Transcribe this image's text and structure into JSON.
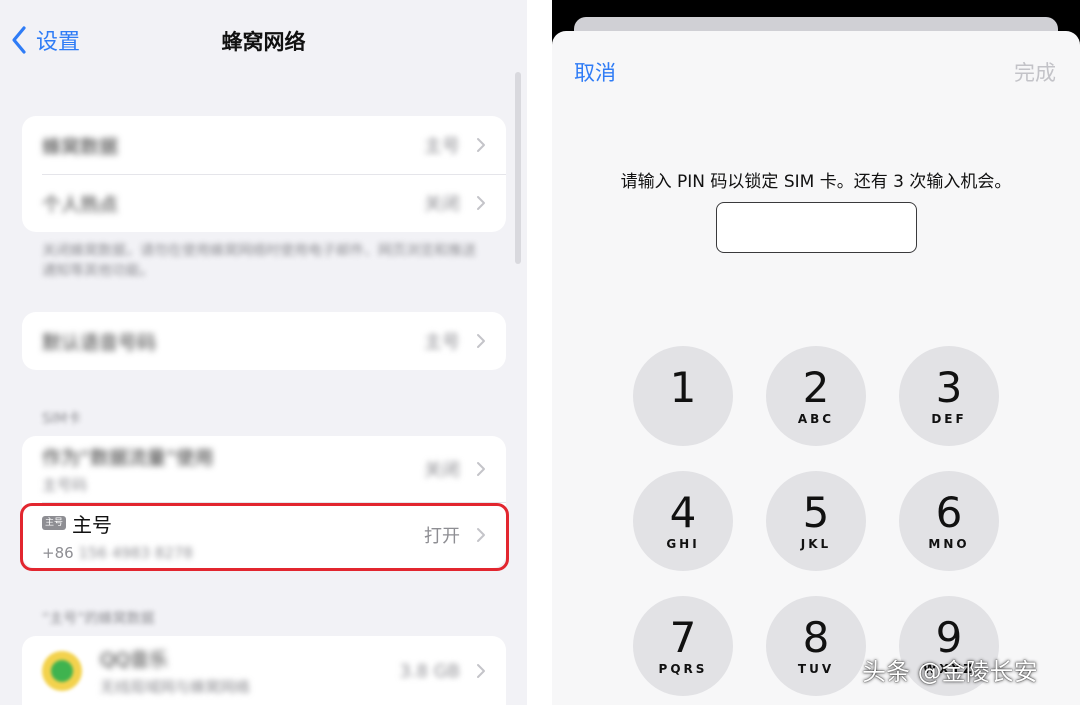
{
  "left": {
    "back_label": "设置",
    "title": "蜂窝网络",
    "group1": [
      {
        "label": "蜂窝数据",
        "value": "主号"
      },
      {
        "label": "个人热点",
        "value": "关闭"
      }
    ],
    "footnote": "关闭蜂窝数据，请勿在使用蜂窝网络时使用电子邮件、网页浏览和推送通知等其他功能。",
    "voice_row": {
      "label": "默认语音号码",
      "value": "主号"
    },
    "sim_header": "SIM卡",
    "data_row": {
      "label": "作为“数据流量”使用",
      "sub": "主号码",
      "value": "关闭"
    },
    "main_row": {
      "badge": "主号",
      "label": "主号",
      "phone_prefix": "+86",
      "phone_rest": "156 4983 8278",
      "value": "打开"
    },
    "usage_header": "“主号”的蜂窝数据",
    "app_row": {
      "name": "QQ音乐",
      "sub": "无线局域网与蜂窝网络",
      "value": "3.8 GB"
    }
  },
  "right": {
    "cancel_label": "取消",
    "done_label": "完成",
    "prompt": "请输入 PIN 码以锁定 SIM 卡。还有 3 次输入机会。",
    "keys": [
      {
        "num": "1",
        "letters": ""
      },
      {
        "num": "2",
        "letters": "ABC"
      },
      {
        "num": "3",
        "letters": "DEF"
      },
      {
        "num": "4",
        "letters": "GHI"
      },
      {
        "num": "5",
        "letters": "JKL"
      },
      {
        "num": "6",
        "letters": "MNO"
      },
      {
        "num": "7",
        "letters": "PQRS"
      },
      {
        "num": "8",
        "letters": "TUV"
      },
      {
        "num": "9",
        "letters": "WXYZ"
      }
    ]
  },
  "watermark": "头条 @金陵长安",
  "colors": {
    "accent": "#2f7cf6",
    "highlight": "#e2262f",
    "key_bg": "#e2e2e5"
  }
}
